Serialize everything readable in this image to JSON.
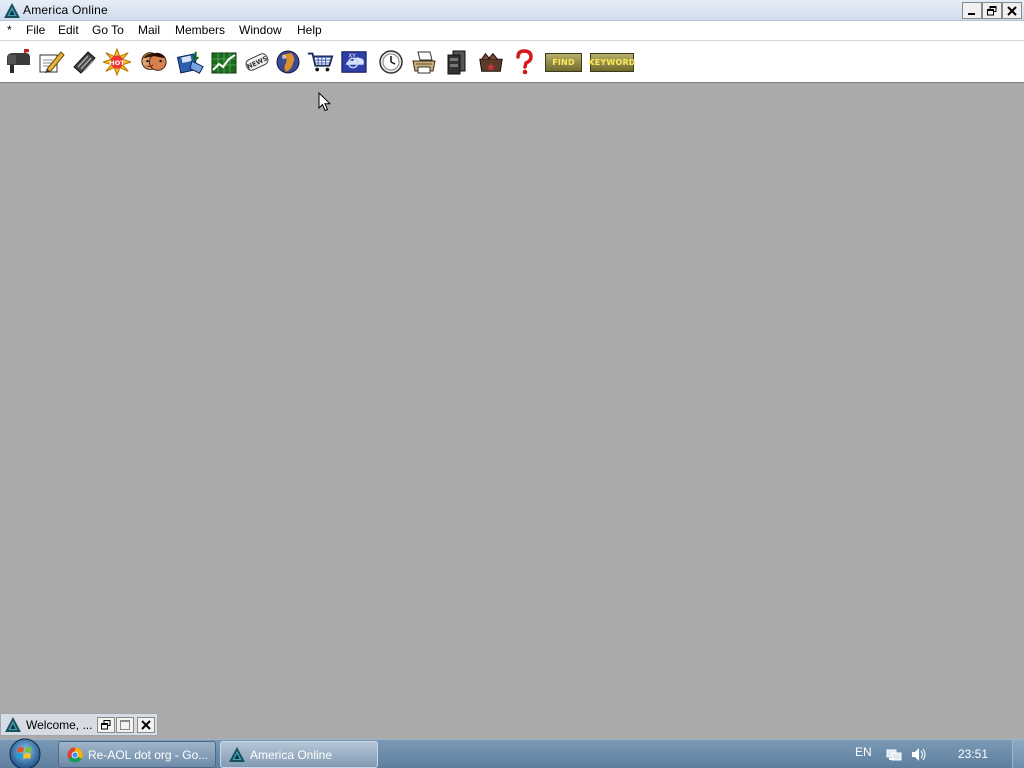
{
  "window": {
    "title": "America  Online",
    "controls": [
      "minimize",
      "restore",
      "close"
    ]
  },
  "menubar": {
    "items": [
      "*",
      "File",
      "Edit",
      "Go To",
      "Mail",
      "Members",
      "Window",
      "Help"
    ]
  },
  "toolbar": {
    "icons": [
      {
        "name": "mailbox-icon"
      },
      {
        "name": "compose-mail-icon"
      },
      {
        "name": "file-cabinet-icon"
      },
      {
        "name": "whats-hot-icon",
        "text": "HOT"
      },
      {
        "name": "people-connection-icon"
      },
      {
        "name": "download-manager-icon"
      },
      {
        "name": "stocks-icon"
      },
      {
        "name": "news-icon",
        "text": "NEWS"
      },
      {
        "name": "internet-globe-icon"
      },
      {
        "name": "shopping-cart-icon"
      },
      {
        "name": "weather-icon"
      },
      {
        "name": "clock-icon"
      },
      {
        "name": "print-icon"
      },
      {
        "name": "my-files-icon"
      },
      {
        "name": "favorite-places-icon"
      },
      {
        "name": "help-icon"
      }
    ],
    "buttons": {
      "find": "FIND",
      "keyword": "KEYWORD"
    }
  },
  "minimized_window": {
    "title": "Welcome, ..."
  },
  "taskbar": {
    "tasks": [
      {
        "label": "Re-AOL dot org - Go...",
        "icon": "chrome-icon",
        "active": false
      },
      {
        "label": "America  Online",
        "icon": "aol-triangle-icon",
        "active": true
      }
    ],
    "tray": {
      "language": "EN",
      "time": "23:51"
    }
  },
  "colors": {
    "workspace": "#aaaaaa",
    "taskbar": "#6d8bab",
    "title_bar": "#d8e4f2",
    "toolbar_button": "#8a8340",
    "toolbar_button_text": "#ffe85a"
  }
}
